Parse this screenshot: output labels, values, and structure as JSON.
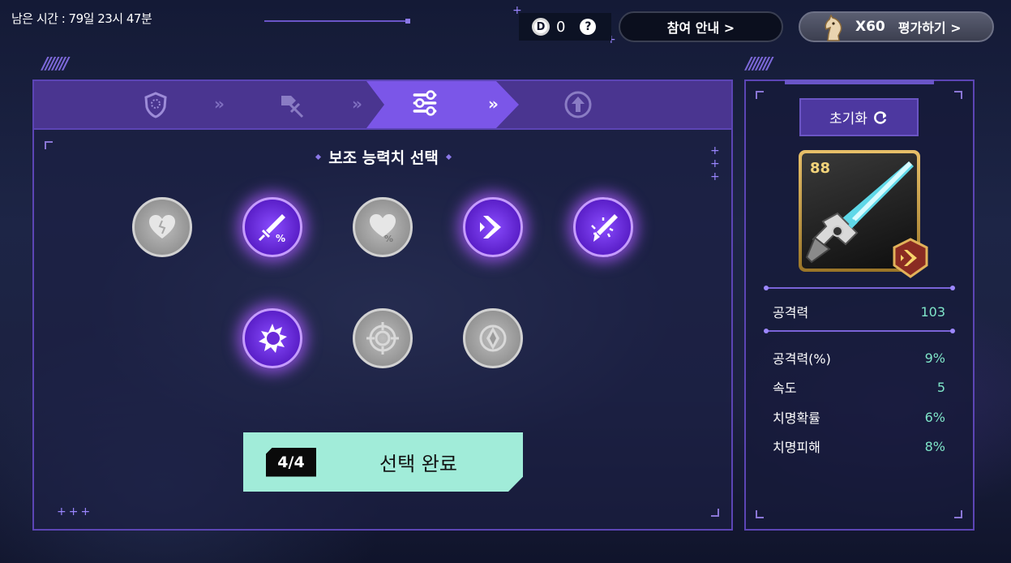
{
  "header": {
    "remaining_time": "남은 시간 : 79일 23시 47분",
    "coin_symbol": "D",
    "coin_count": "0",
    "help_symbol": "?",
    "guide_button": "참여 안내 >",
    "rate_count": "X60",
    "rate_button": "평가하기 >"
  },
  "steps": {
    "items": [
      {
        "icon": "shield-icon",
        "active": false
      },
      {
        "icon": "crossed-swords-icon",
        "active": false
      },
      {
        "icon": "sliders-icon",
        "active": true
      },
      {
        "icon": "upgrade-arrow-icon",
        "active": false
      }
    ],
    "separator": "»"
  },
  "main": {
    "title": "보조 능력치 선택",
    "abilities": [
      {
        "icon": "heart-icon",
        "selected": false
      },
      {
        "icon": "sword-percent-icon",
        "selected": true
      },
      {
        "icon": "heart-percent-icon",
        "selected": false
      },
      {
        "icon": "speed-chevron-icon",
        "selected": true
      },
      {
        "icon": "critical-sword-icon",
        "selected": true
      },
      {
        "icon": "crit-burst-icon",
        "selected": true
      },
      {
        "icon": "target-icon",
        "selected": false
      },
      {
        "icon": "diamond-shield-icon",
        "selected": false
      }
    ],
    "confirm": {
      "count": "4/4",
      "label": "선택 완료"
    }
  },
  "side": {
    "reset_label": "초기화",
    "weapon_level": "88",
    "primary_stat": {
      "name": "공격력",
      "value": "103"
    },
    "stats": [
      {
        "name": "공격력(%)",
        "value": "9%"
      },
      {
        "name": "속도",
        "value": "5"
      },
      {
        "name": "치명확률",
        "value": "6%"
      },
      {
        "name": "치명피해",
        "value": "8%"
      }
    ]
  },
  "colors": {
    "accent_purple": "#7b56e8",
    "selected_glow": "#a65aff",
    "confirm_mint": "#a1ecd9",
    "stat_value": "#7fe6c9"
  }
}
